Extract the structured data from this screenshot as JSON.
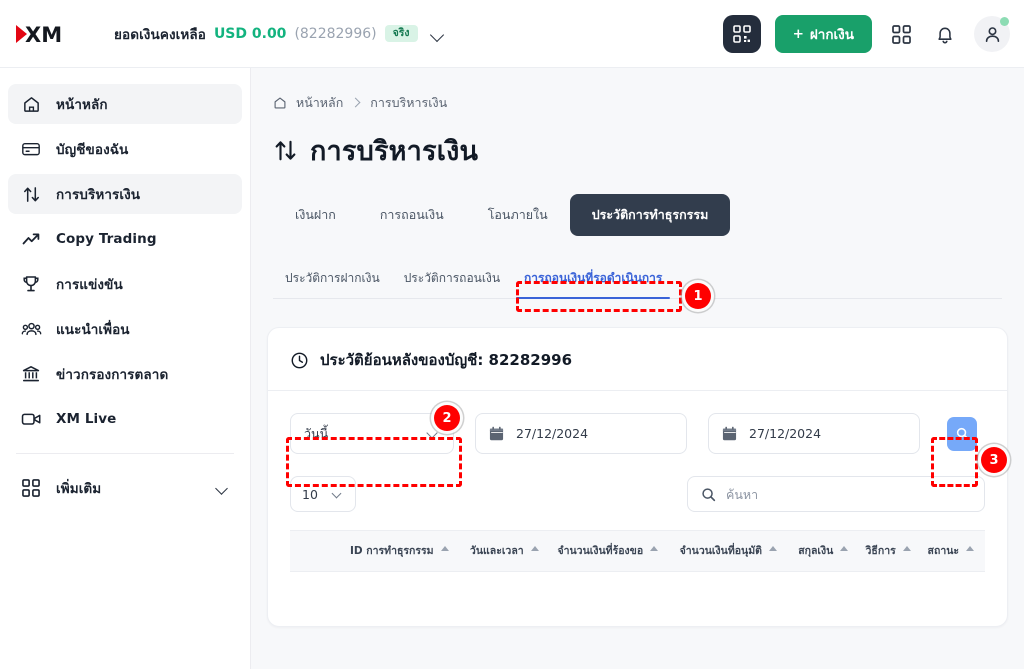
{
  "header": {
    "logo_alt": "XM",
    "balance_label": "ยอดเงินคงเหลือ",
    "balance_amount": "USD 0.00",
    "account_number": "(82282996)",
    "account_type_badge": "จริง",
    "deposit_button": "+ ฝากเงิน",
    "deposit_plus": "+",
    "deposit_text": "ฝากเงิน",
    "qr_icon": "qr-code-icon",
    "apps_icon": "grid-apps-icon",
    "bell_icon": "notification-bell-icon",
    "profile_icon": "user-profile-icon",
    "accent_green": "#19a06a",
    "balance_green": "#13b37f"
  },
  "sidebar": {
    "items": [
      {
        "label": "หน้าหลัก",
        "icon": "home-icon",
        "active": true
      },
      {
        "label": "บัญชีของฉัน",
        "icon": "card-icon",
        "active": false
      },
      {
        "label": "การบริหารเงิน",
        "icon": "transfer-arrows-icon",
        "active": true
      },
      {
        "label": "Copy Trading",
        "icon": "trend-up-icon",
        "active": false
      },
      {
        "label": "การแข่งขัน",
        "icon": "trophy-icon",
        "active": false
      },
      {
        "label": "แนะนำเพื่อน",
        "icon": "people-group-icon",
        "active": false
      },
      {
        "label": "ข่าวกรองการตลาด",
        "icon": "bank-icon",
        "active": false
      },
      {
        "label": "XM Live",
        "icon": "video-camera-icon",
        "active": false
      }
    ],
    "more": {
      "label": "เพิ่มเติม",
      "icon": "grid-apps-icon"
    }
  },
  "main": {
    "breadcrumb": {
      "home_icon": "home-icon",
      "home": "หน้าหลัก",
      "current": "การบริหารเงิน"
    },
    "page_title": "การบริหารเงิน",
    "page_title_icon": "transfer-arrows-icon",
    "tabs": [
      {
        "label": "เงินฝาก",
        "active": false
      },
      {
        "label": "การถอนเงิน",
        "active": false
      },
      {
        "label": "โอนภายใน",
        "active": false
      },
      {
        "label": "ประวัติการทำธุรกรรม",
        "active": true
      }
    ],
    "subtabs": [
      {
        "label": "ประวัติการฝากเงิน",
        "active": false
      },
      {
        "label": "ประวัติการถอนเงิน",
        "active": false
      },
      {
        "label": "การถอนเงินที่รอดำเนินการ",
        "active": true
      }
    ],
    "card": {
      "clock_icon": "clock-icon",
      "title": "ประวัติย้อนหลังของบัญชี: 82282996",
      "period_select": {
        "value": "วันนี้",
        "chevron_icon": "chevron-down-icon"
      },
      "date_from": {
        "value": "27/12/2024",
        "icon": "calendar-icon"
      },
      "date_to": {
        "value": "27/12/2024",
        "icon": "calendar-icon"
      },
      "search_go": {
        "icon": "search-icon",
        "color": "#76a9f9"
      },
      "per_page": {
        "value": "10",
        "chevron_icon": "chevron-down-icon"
      },
      "search": {
        "placeholder": "ค้นหา",
        "value": "",
        "icon": "search-icon"
      },
      "table": {
        "columns": [
          "ID การทำธุรกรรม",
          "วันและเวลา",
          "จำนวนเงินที่ร้องขอ",
          "จำนวนเงินที่อนุมัติ",
          "สกุลเงิน",
          "วิธีการ",
          "สถานะ"
        ],
        "sort_icon": "sort-caret-up-icon",
        "rows": []
      }
    }
  },
  "annotations": [
    {
      "number": "1",
      "target": "pending-withdrawals-subtab"
    },
    {
      "number": "2",
      "target": "period-select"
    },
    {
      "number": "3",
      "target": "search-go-button"
    }
  ],
  "colors": {
    "annotation_red": "#ff0000",
    "active_tab_blue": "#3a63d8",
    "dark_tab_bg": "#323d4d"
  }
}
